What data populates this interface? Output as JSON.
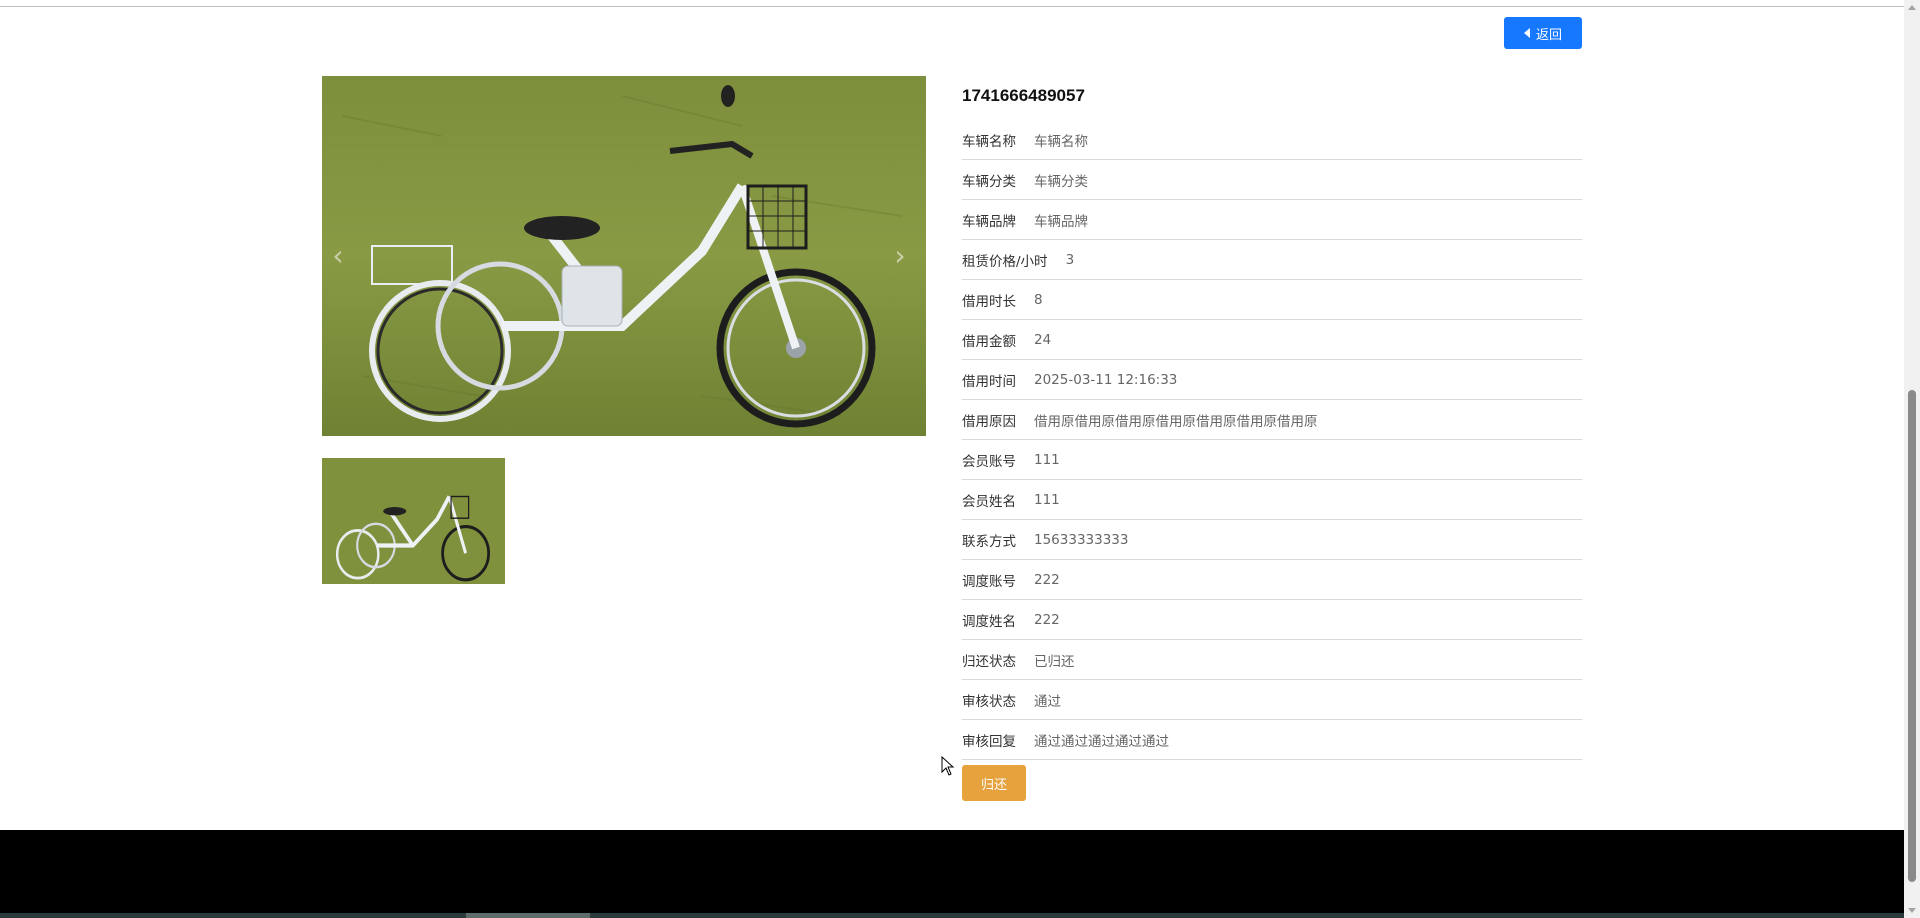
{
  "header": {
    "back_label": "返回"
  },
  "gallery": {
    "main_image_alt": "三轮电动车",
    "thumb_alt": "三轮电动车缩略图",
    "prev_glyph": "‹",
    "next_glyph": "›"
  },
  "detail": {
    "order_no": "1741666489057",
    "rows": [
      {
        "label": "车辆名称",
        "value": "车辆名称"
      },
      {
        "label": "车辆分类",
        "value": "车辆分类"
      },
      {
        "label": "车辆品牌",
        "value": "车辆品牌"
      },
      {
        "label": "租赁价格/小时",
        "value": "3"
      },
      {
        "label": "借用时长",
        "value": "8"
      },
      {
        "label": "借用金额",
        "value": "24"
      },
      {
        "label": "借用时间",
        "value": "2025-03-11 12:16:33"
      },
      {
        "label": "借用原因",
        "value": "借用原借用原借用原借用原借用原借用原借用原"
      },
      {
        "label": "会员账号",
        "value": "111"
      },
      {
        "label": "会员姓名",
        "value": "111"
      },
      {
        "label": "联系方式",
        "value": "15633333333"
      },
      {
        "label": "调度账号",
        "value": "222"
      },
      {
        "label": "调度姓名",
        "value": "222"
      },
      {
        "label": "归还状态",
        "value": "已归还"
      },
      {
        "label": "审核状态",
        "value": "通过"
      },
      {
        "label": "审核回复",
        "value": "通过通过通过通过通过"
      }
    ],
    "return_label": "归还"
  },
  "colors": {
    "primary": "#1677ff",
    "warning": "#e6a23c",
    "footer": "#000000"
  }
}
